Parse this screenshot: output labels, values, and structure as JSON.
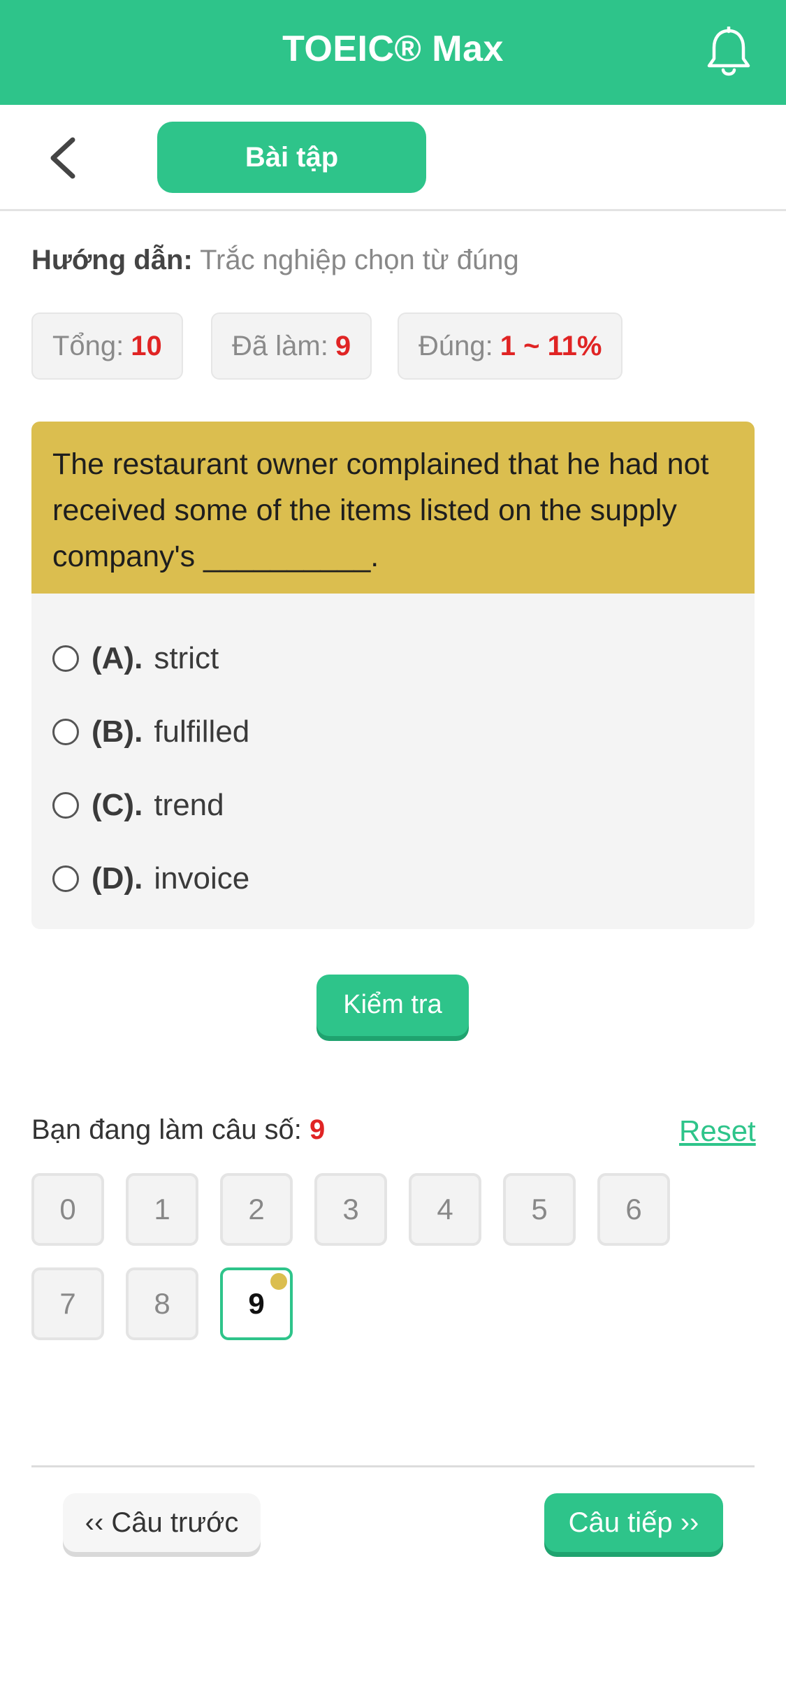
{
  "header": {
    "title": "TOEIC® Max",
    "notification_icon": "bell-icon"
  },
  "subbar": {
    "back_icon": "chevron-left-icon",
    "tab_label": "Bài tập"
  },
  "instructions": {
    "label": "Hướng dẫn:",
    "text": "Trắc nghiệp chọn từ đúng"
  },
  "stats": {
    "total_label": "Tổng:",
    "total_value": "10",
    "done_label": "Đã làm:",
    "done_value": "9",
    "correct_label": "Đúng:",
    "correct_value": "1 ~ 11%"
  },
  "question": {
    "text": "The restaurant owner complained that he had not received some of the items listed on the supply company's __________."
  },
  "options": [
    {
      "letter": "(A).",
      "text": "strict"
    },
    {
      "letter": "(B).",
      "text": "fulfilled"
    },
    {
      "letter": "(C).",
      "text": "trend"
    },
    {
      "letter": "(D).",
      "text": "invoice"
    }
  ],
  "check_button": "Kiểm tra",
  "progress": {
    "label": "Bạn đang làm câu số:",
    "current": "9",
    "reset_label": "Reset",
    "numbers": [
      "0",
      "1",
      "2",
      "3",
      "4",
      "5",
      "6",
      "7",
      "8",
      "9"
    ]
  },
  "navigation": {
    "prev_label": "‹‹ Câu trước",
    "next_label": "Câu tiếp ››"
  },
  "colors": {
    "brand_green": "#2ec48a",
    "question_bg": "#dbbe4f",
    "accent_red": "#e02424"
  }
}
